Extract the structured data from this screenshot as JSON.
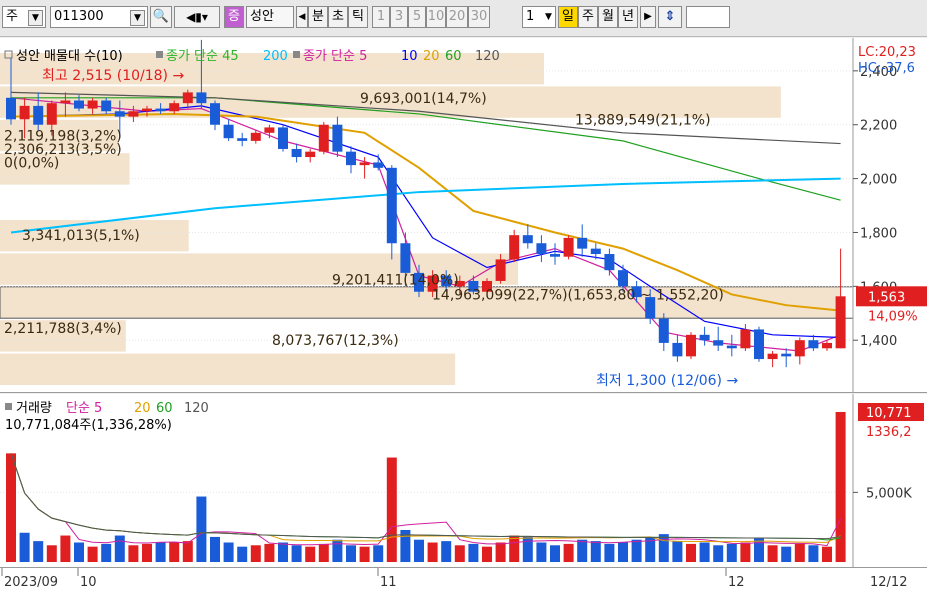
{
  "toolbar": {
    "market": "주",
    "code": "011300",
    "badge": "증",
    "name": "성안",
    "period_btns": [
      "분",
      "초",
      "틱"
    ],
    "number_btns": [
      "1",
      "3",
      "5",
      "10",
      "20",
      "30"
    ],
    "count": "1",
    "period_selected": "일",
    "period_btns2": [
      "주",
      "월",
      "년"
    ]
  },
  "main_pane": {
    "legend_items": [
      {
        "text": "성안 매물대 수(10)",
        "color": "#000000"
      },
      {
        "text": "종가 단순 45",
        "color": "#2bb52b"
      },
      {
        "text": "200",
        "color": "#00bfff"
      },
      {
        "text": "종가 단순 5",
        "color": "#d020a0"
      },
      {
        "text": "10",
        "color": "#0000ff"
      },
      {
        "text": "20",
        "color": "#e0a000"
      },
      {
        "text": "60",
        "color": "#20a020"
      },
      {
        "text": "120",
        "color": "#555555"
      }
    ],
    "lc_text": "LC:20,23",
    "hc_text": "HC:-37,6",
    "price_box": "1,563",
    "pct_text": "14,09%",
    "high_note": "최고 2,515 (10/18) →",
    "low_note": "최저 1,300 (12/06) →",
    "y_ticks": [
      "2,400",
      "2,200",
      "2,000",
      "1,800",
      "1,600",
      "1,400"
    ],
    "volume_profile_labels": [
      "9,693,001(14,7%)",
      "13,889,549(21,1%)",
      "2,119,198(3,2%)",
      "2,306,213(3,5%)",
      "0(0,0%)",
      "3,341,013(5,1%)",
      "9,201,411(14,0%)",
      "14,963,099(22,7%)(1,653,80 ~ 1,552,20)",
      "2,211,788(3,4%)",
      "8,073,767(12,3%)"
    ]
  },
  "volume_pane": {
    "legend_items": [
      {
        "text": "거래량",
        "color": "#000000"
      },
      {
        "text": "단순 5",
        "color": "#d020a0"
      },
      {
        "text": "20",
        "color": "#e0a000"
      },
      {
        "text": "60",
        "color": "#20a020"
      },
      {
        "text": "120",
        "color": "#555555"
      }
    ],
    "value_text": "10,771,084주(1,336,28%)",
    "box1": "10,771",
    "box2": "1336,2",
    "y_tick": "5,000K"
  },
  "x_axis": {
    "labels": [
      "2023/09",
      "10",
      "11",
      "12"
    ],
    "last_date": "12/12"
  },
  "chart_data": [
    {
      "type": "candlestick",
      "ylim": [
        1230,
        2470
      ],
      "y_ticks": [
        2400,
        2200,
        2000,
        1800,
        1600,
        1400
      ],
      "candles": [
        {
          "o": 2300,
          "h": 2450,
          "l": 2200,
          "c": 2220
        },
        {
          "o": 2220,
          "h": 2300,
          "l": 2150,
          "c": 2270
        },
        {
          "o": 2270,
          "h": 2320,
          "l": 2180,
          "c": 2200
        },
        {
          "o": 2200,
          "h": 2290,
          "l": 2160,
          "c": 2280
        },
        {
          "o": 2280,
          "h": 2320,
          "l": 2230,
          "c": 2290
        },
        {
          "o": 2290,
          "h": 2310,
          "l": 2250,
          "c": 2260
        },
        {
          "o": 2260,
          "h": 2300,
          "l": 2240,
          "c": 2290
        },
        {
          "o": 2290,
          "h": 2300,
          "l": 2240,
          "c": 2250
        },
        {
          "o": 2250,
          "h": 2290,
          "l": 2150,
          "c": 2230
        },
        {
          "o": 2230,
          "h": 2270,
          "l": 2210,
          "c": 2250
        },
        {
          "o": 2250,
          "h": 2270,
          "l": 2230,
          "c": 2260
        },
        {
          "o": 2260,
          "h": 2280,
          "l": 2240,
          "c": 2250
        },
        {
          "o": 2250,
          "h": 2290,
          "l": 2240,
          "c": 2280
        },
        {
          "o": 2280,
          "h": 2330,
          "l": 2260,
          "c": 2320
        },
        {
          "o": 2320,
          "h": 2515,
          "l": 2260,
          "c": 2280
        },
        {
          "o": 2280,
          "h": 2290,
          "l": 2180,
          "c": 2200
        },
        {
          "o": 2200,
          "h": 2220,
          "l": 2140,
          "c": 2150
        },
        {
          "o": 2150,
          "h": 2170,
          "l": 2120,
          "c": 2140
        },
        {
          "o": 2140,
          "h": 2180,
          "l": 2130,
          "c": 2170
        },
        {
          "o": 2170,
          "h": 2200,
          "l": 2150,
          "c": 2190
        },
        {
          "o": 2190,
          "h": 2200,
          "l": 2100,
          "c": 2110
        },
        {
          "o": 2110,
          "h": 2130,
          "l": 2060,
          "c": 2080
        },
        {
          "o": 2080,
          "h": 2110,
          "l": 2060,
          "c": 2100
        },
        {
          "o": 2100,
          "h": 2210,
          "l": 2090,
          "c": 2200
        },
        {
          "o": 2200,
          "h": 2230,
          "l": 2080,
          "c": 2100
        },
        {
          "o": 2100,
          "h": 2120,
          "l": 2020,
          "c": 2050
        },
        {
          "o": 2050,
          "h": 2080,
          "l": 2000,
          "c": 2060
        },
        {
          "o": 2060,
          "h": 2090,
          "l": 2030,
          "c": 2040
        },
        {
          "o": 2040,
          "h": 2050,
          "l": 1700,
          "c": 1760
        },
        {
          "o": 1760,
          "h": 1800,
          "l": 1600,
          "c": 1650
        },
        {
          "o": 1650,
          "h": 1680,
          "l": 1560,
          "c": 1580
        },
        {
          "o": 1580,
          "h": 1660,
          "l": 1560,
          "c": 1640
        },
        {
          "o": 1640,
          "h": 1660,
          "l": 1580,
          "c": 1600
        },
        {
          "o": 1600,
          "h": 1640,
          "l": 1570,
          "c": 1620
        },
        {
          "o": 1620,
          "h": 1640,
          "l": 1570,
          "c": 1580
        },
        {
          "o": 1580,
          "h": 1630,
          "l": 1560,
          "c": 1620
        },
        {
          "o": 1620,
          "h": 1720,
          "l": 1610,
          "c": 1700
        },
        {
          "o": 1700,
          "h": 1810,
          "l": 1690,
          "c": 1790
        },
        {
          "o": 1790,
          "h": 1830,
          "l": 1740,
          "c": 1760
        },
        {
          "o": 1760,
          "h": 1790,
          "l": 1690,
          "c": 1720
        },
        {
          "o": 1720,
          "h": 1760,
          "l": 1680,
          "c": 1710
        },
        {
          "o": 1710,
          "h": 1790,
          "l": 1700,
          "c": 1780
        },
        {
          "o": 1780,
          "h": 1830,
          "l": 1710,
          "c": 1740
        },
        {
          "o": 1740,
          "h": 1760,
          "l": 1700,
          "c": 1720
        },
        {
          "o": 1720,
          "h": 1740,
          "l": 1640,
          "c": 1660
        },
        {
          "o": 1660,
          "h": 1680,
          "l": 1580,
          "c": 1600
        },
        {
          "o": 1600,
          "h": 1620,
          "l": 1540,
          "c": 1560
        },
        {
          "o": 1560,
          "h": 1590,
          "l": 1460,
          "c": 1480
        },
        {
          "o": 1480,
          "h": 1500,
          "l": 1360,
          "c": 1390
        },
        {
          "o": 1390,
          "h": 1420,
          "l": 1320,
          "c": 1340
        },
        {
          "o": 1340,
          "h": 1430,
          "l": 1330,
          "c": 1420
        },
        {
          "o": 1420,
          "h": 1450,
          "l": 1380,
          "c": 1400
        },
        {
          "o": 1400,
          "h": 1450,
          "l": 1360,
          "c": 1380
        },
        {
          "o": 1380,
          "h": 1420,
          "l": 1340,
          "c": 1370
        },
        {
          "o": 1370,
          "h": 1460,
          "l": 1360,
          "c": 1440
        },
        {
          "o": 1440,
          "h": 1450,
          "l": 1320,
          "c": 1330
        },
        {
          "o": 1330,
          "h": 1360,
          "l": 1300,
          "c": 1350
        },
        {
          "o": 1350,
          "h": 1370,
          "l": 1300,
          "c": 1340
        },
        {
          "o": 1340,
          "h": 1410,
          "l": 1310,
          "c": 1400
        },
        {
          "o": 1400,
          "h": 1420,
          "l": 1360,
          "c": 1370
        },
        {
          "o": 1370,
          "h": 1400,
          "l": 1360,
          "c": 1390
        },
        {
          "o": 1370,
          "h": 1740,
          "l": 1370,
          "c": 1563
        }
      ],
      "ma_lines": [
        {
          "name": "5",
          "color": "#d020a0",
          "points": [
            [
              0,
              2300
            ],
            [
              10,
              2250
            ],
            [
              14,
              2260
            ],
            [
              20,
              2140
            ],
            [
              27,
              2050
            ],
            [
              30,
              1640
            ],
            [
              33,
              1600
            ],
            [
              36,
              1690
            ],
            [
              40,
              1740
            ],
            [
              44,
              1660
            ],
            [
              48,
              1430
            ],
            [
              52,
              1390
            ],
            [
              58,
              1360
            ],
            [
              61,
              1420
            ]
          ]
        },
        {
          "name": "10",
          "color": "#0000ff",
          "points": [
            [
              0,
              2230
            ],
            [
              8,
              2240
            ],
            [
              14,
              2270
            ],
            [
              20,
              2200
            ],
            [
              27,
              2080
            ],
            [
              31,
              1780
            ],
            [
              35,
              1670
            ],
            [
              40,
              1730
            ],
            [
              44,
              1700
            ],
            [
              47,
              1600
            ],
            [
              51,
              1470
            ],
            [
              56,
              1420
            ],
            [
              61,
              1410
            ]
          ]
        },
        {
          "name": "20",
          "color": "#e0a000",
          "points": [
            [
              0,
              2230
            ],
            [
              12,
              2240
            ],
            [
              18,
              2230
            ],
            [
              26,
              2170
            ],
            [
              30,
              2040
            ],
            [
              34,
              1880
            ],
            [
              40,
              1800
            ],
            [
              45,
              1740
            ],
            [
              49,
              1660
            ],
            [
              53,
              1570
            ],
            [
              57,
              1530
            ],
            [
              61,
              1510
            ]
          ]
        },
        {
          "name": "60",
          "color": "#20a020",
          "points": [
            [
              0,
              2300
            ],
            [
              15,
              2300
            ],
            [
              30,
              2240
            ],
            [
              45,
              2140
            ],
            [
              55,
              2000
            ],
            [
              61,
              1920
            ]
          ]
        },
        {
          "name": "120",
          "color": "#555555",
          "points": [
            [
              0,
              2320
            ],
            [
              15,
              2300
            ],
            [
              30,
              2250
            ],
            [
              45,
              2170
            ],
            [
              61,
              2130
            ]
          ]
        },
        {
          "name": "200",
          "color": "#00bfff",
          "points": [
            [
              0,
              1800
            ],
            [
              15,
              1890
            ],
            [
              30,
              1950
            ],
            [
              45,
              1980
            ],
            [
              61,
              2000
            ]
          ]
        }
      ]
    },
    {
      "type": "bar",
      "unit": "K",
      "ylim": [
        0,
        11200
      ],
      "y_ticks": [
        5000
      ],
      "volumes": [
        7800,
        2100,
        1500,
        1200,
        1900,
        1400,
        1100,
        1300,
        1900,
        1200,
        1300,
        1400,
        1400,
        1500,
        4700,
        1800,
        1400,
        1100,
        1200,
        1300,
        1400,
        1200,
        1100,
        1300,
        1600,
        1200,
        1100,
        1200,
        7500,
        2300,
        1600,
        1400,
        1500,
        1200,
        1300,
        1100,
        1400,
        1900,
        1800,
        1400,
        1200,
        1300,
        1600,
        1500,
        1300,
        1400,
        1600,
        1800,
        2000,
        1500,
        1300,
        1400,
        1200,
        1300,
        1400,
        1700,
        1200,
        1100,
        1300,
        1200,
        1100,
        10771
      ],
      "volume_colors": [
        "r",
        "b",
        "b",
        "r",
        "r",
        "b",
        "r",
        "b",
        "b",
        "r",
        "r",
        "b",
        "r",
        "r",
        "b",
        "b",
        "b",
        "b",
        "r",
        "r",
        "b",
        "b",
        "r",
        "r",
        "b",
        "b",
        "r",
        "b",
        "r",
        "b",
        "b",
        "r",
        "b",
        "r",
        "b",
        "r",
        "r",
        "r",
        "b",
        "b",
        "b",
        "r",
        "b",
        "b",
        "b",
        "b",
        "b",
        "b",
        "b",
        "b",
        "r",
        "b",
        "b",
        "b",
        "r",
        "b",
        "r",
        "b",
        "r",
        "b",
        "r",
        "r"
      ]
    }
  ]
}
